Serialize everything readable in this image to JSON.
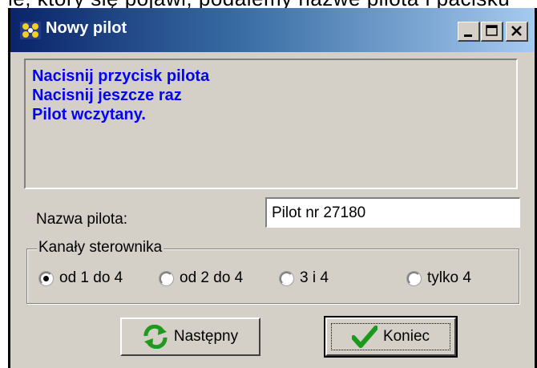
{
  "background_text": "ie, który się pojawi, podaiemy nazwe pilota i pacisku",
  "window": {
    "title": "Nowy pilot",
    "controls": {
      "minimize_icon": "minimize-icon",
      "maximize_icon": "maximize-icon",
      "close_icon": "close-icon"
    }
  },
  "messages": [
    "Nacisnij przycisk pilota",
    "Nacisnij jeszcze raz",
    "Pilot wczytany."
  ],
  "name_field": {
    "label": "Nazwa pilota:",
    "value": "Pilot nr 27180"
  },
  "channels": {
    "legend": "Kanały sterownika",
    "options": [
      {
        "label": "od 1 do 4",
        "checked": true
      },
      {
        "label": "od 2 do 4",
        "checked": false
      },
      {
        "label": "3 i 4",
        "checked": false
      },
      {
        "label": "tylko 4",
        "checked": false
      }
    ]
  },
  "buttons": {
    "next": {
      "label": "Następny",
      "icon": "refresh-icon"
    },
    "end": {
      "label": "Koniec",
      "icon": "checkmark-icon"
    }
  },
  "colors": {
    "message_text": "#0000ff",
    "titlebar_start": "#0a246a",
    "titlebar_end": "#a6caf0",
    "face": "#d4d0c8"
  }
}
